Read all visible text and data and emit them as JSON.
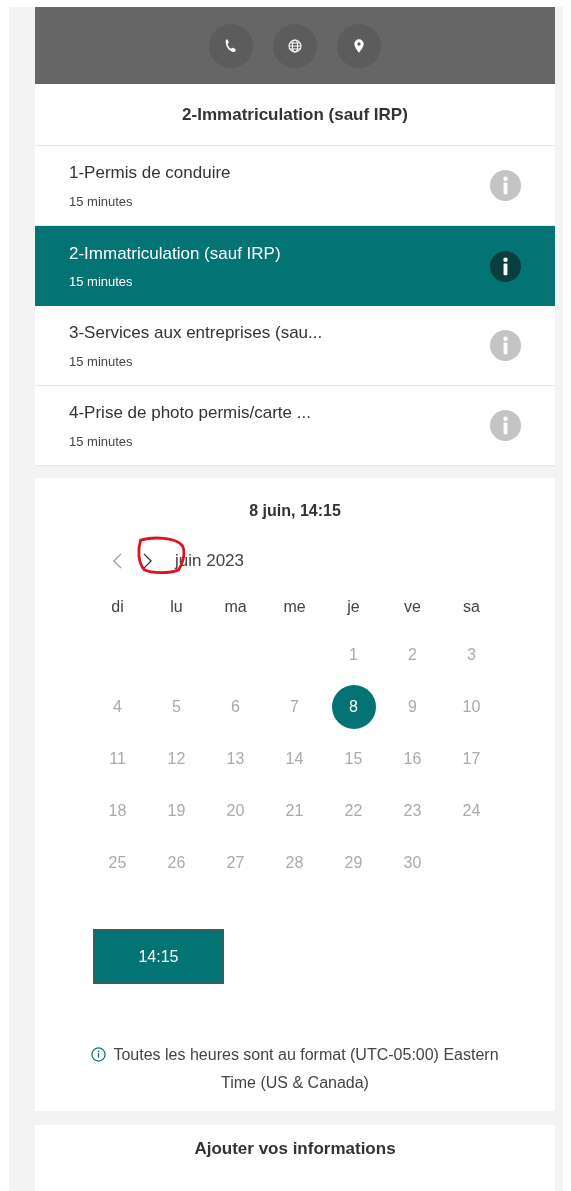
{
  "header": {
    "actions": [
      {
        "kind": "phone"
      },
      {
        "kind": "web"
      },
      {
        "kind": "location"
      }
    ]
  },
  "service_title": "2-Immatriculation (sauf IRP)",
  "services": [
    {
      "name": "1-Permis de conduire",
      "duration": "15 minutes",
      "selected": false
    },
    {
      "name": "2-Immatriculation (sauf IRP)",
      "duration": "15 minutes",
      "selected": true
    },
    {
      "name": "3-Services aux entreprises (sau...",
      "duration": "15 minutes",
      "selected": false
    },
    {
      "name": "4-Prise de photo permis/carte ...",
      "duration": "15 minutes",
      "selected": false
    }
  ],
  "calendar": {
    "title": "8 juin, 14:15",
    "month": "juin 2023",
    "weekdays": [
      "di",
      "lu",
      "ma",
      "me",
      "je",
      "ve",
      "sa"
    ],
    "weeks": [
      [
        {
          "label": "1",
          "selected": false
        },
        {
          "label": "2",
          "selected": false
        },
        {
          "label": "3",
          "selected": false
        }
      ],
      [
        {
          "label": "4",
          "selected": false
        },
        {
          "label": "5",
          "selected": false
        },
        {
          "label": "6",
          "selected": false
        },
        {
          "label": "7",
          "selected": false
        },
        {
          "label": "8",
          "selected": true
        },
        {
          "label": "9",
          "selected": false
        },
        {
          "label": "10",
          "selected": false
        }
      ],
      [
        {
          "label": "11",
          "selected": false
        },
        {
          "label": "12",
          "selected": false
        },
        {
          "label": "13",
          "selected": false
        },
        {
          "label": "14",
          "selected": false
        },
        {
          "label": "15",
          "selected": false
        },
        {
          "label": "16",
          "selected": false
        },
        {
          "label": "17",
          "selected": false
        }
      ],
      [
        {
          "label": "18",
          "selected": false
        },
        {
          "label": "19",
          "selected": false
        },
        {
          "label": "20",
          "selected": false
        },
        {
          "label": "21",
          "selected": false
        },
        {
          "label": "22",
          "selected": false
        },
        {
          "label": "23",
          "selected": false
        },
        {
          "label": "24",
          "selected": false
        }
      ],
      [
        {
          "label": "25",
          "selected": false
        },
        {
          "label": "26",
          "selected": false
        },
        {
          "label": "27",
          "selected": false
        },
        {
          "label": "28",
          "selected": false
        },
        {
          "label": "29",
          "selected": false
        },
        {
          "label": "30",
          "selected": false
        }
      ]
    ]
  },
  "times": [
    {
      "label": "14:15",
      "selected": true
    }
  ],
  "timezone_note": "Toutes les heures sont au format (UTC-05:00) Eastern Time (US & Canada)",
  "next_section": "Ajouter vos informations"
}
